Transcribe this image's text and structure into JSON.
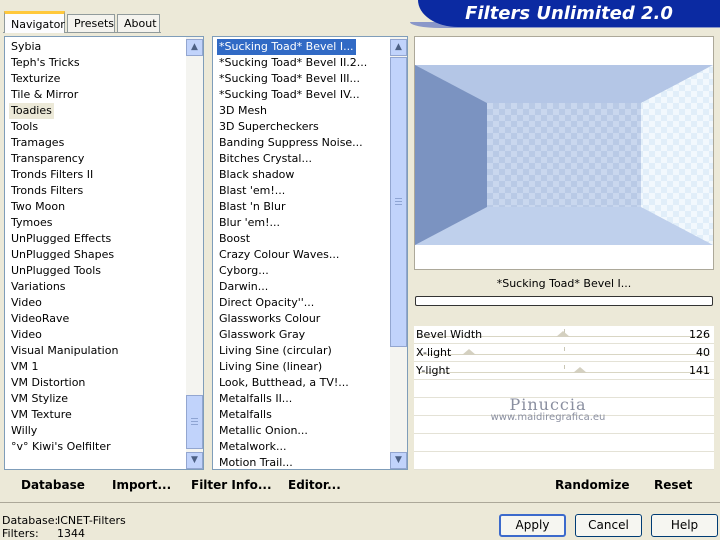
{
  "app": {
    "title": "Filters Unlimited 2.0"
  },
  "tabs": [
    {
      "label": "Navigator",
      "active": true
    },
    {
      "label": "Presets",
      "active": false
    },
    {
      "label": "About",
      "active": false
    }
  ],
  "categories": {
    "selected": "Toadies",
    "items": [
      "Sybia",
      "Teph's Tricks",
      "Texturize",
      "Tile & Mirror",
      "Toadies",
      "Tools",
      "Tramages",
      "Transparency",
      "Tronds Filters II",
      "Tronds Filters",
      "Two Moon",
      "Tymoes",
      "UnPlugged Effects",
      "UnPlugged Shapes",
      "UnPlugged Tools",
      "Variations",
      "Video",
      "VideoRave",
      "Video",
      "Visual Manipulation",
      "VM 1",
      "VM Distortion",
      "VM Stylize",
      "VM Texture",
      "Willy",
      "°v° Kiwi's Oelfilter"
    ]
  },
  "filters": {
    "selected": "*Sucking Toad*  Bevel I...",
    "items": [
      "*Sucking Toad*  Bevel I...",
      "*Sucking Toad*  Bevel II.2...",
      "*Sucking Toad*  Bevel III...",
      "*Sucking Toad*  Bevel IV...",
      "3D Mesh",
      "3D Supercheckers",
      "Banding Suppress Noise...",
      "Bitches Crystal...",
      "Black shadow",
      "Blast 'em!...",
      "Blast 'n Blur",
      "Blur 'em!...",
      "Boost",
      "Crazy Colour Waves...",
      "Cyborg...",
      "Darwin...",
      "Direct Opacity''...",
      "Glassworks Colour",
      "Glasswork Gray",
      "Living Sine (circular)",
      "Living Sine (linear)",
      "Look, Butthead, a TV!...",
      "Metalfalls II...",
      "Metalfalls",
      "Metallic Onion...",
      "Metalwork...",
      "Motion Trail..."
    ]
  },
  "preview": {
    "caption": "*Sucking Toad*  Bevel I...",
    "progress": 0
  },
  "params": [
    {
      "label": "Bevel Width",
      "value": "126",
      "max": 255
    },
    {
      "label": "X-light",
      "value": "40",
      "max": 255
    },
    {
      "label": "Y-light",
      "value": "141",
      "max": 255
    }
  ],
  "watermark": {
    "line1": "Pinuccia",
    "line2": "www.maidiregrafica.eu"
  },
  "toolbar": {
    "database": "Database",
    "import": "Import...",
    "filter_info": "Filter Info...",
    "editor": "Editor...",
    "randomize": "Randomize",
    "reset": "Reset"
  },
  "status": {
    "database_label": "Database:",
    "database_value": "ICNET-Filters",
    "filters_label": "Filters:",
    "filters_value": "1344"
  },
  "buttons": {
    "apply": "Apply",
    "cancel": "Cancel",
    "help": "Help"
  },
  "colors": {
    "banner": "#0b2aa2",
    "selection": "#316ac5",
    "preview_light": "#c6d6ef",
    "preview_dark": "#7f97c4"
  }
}
